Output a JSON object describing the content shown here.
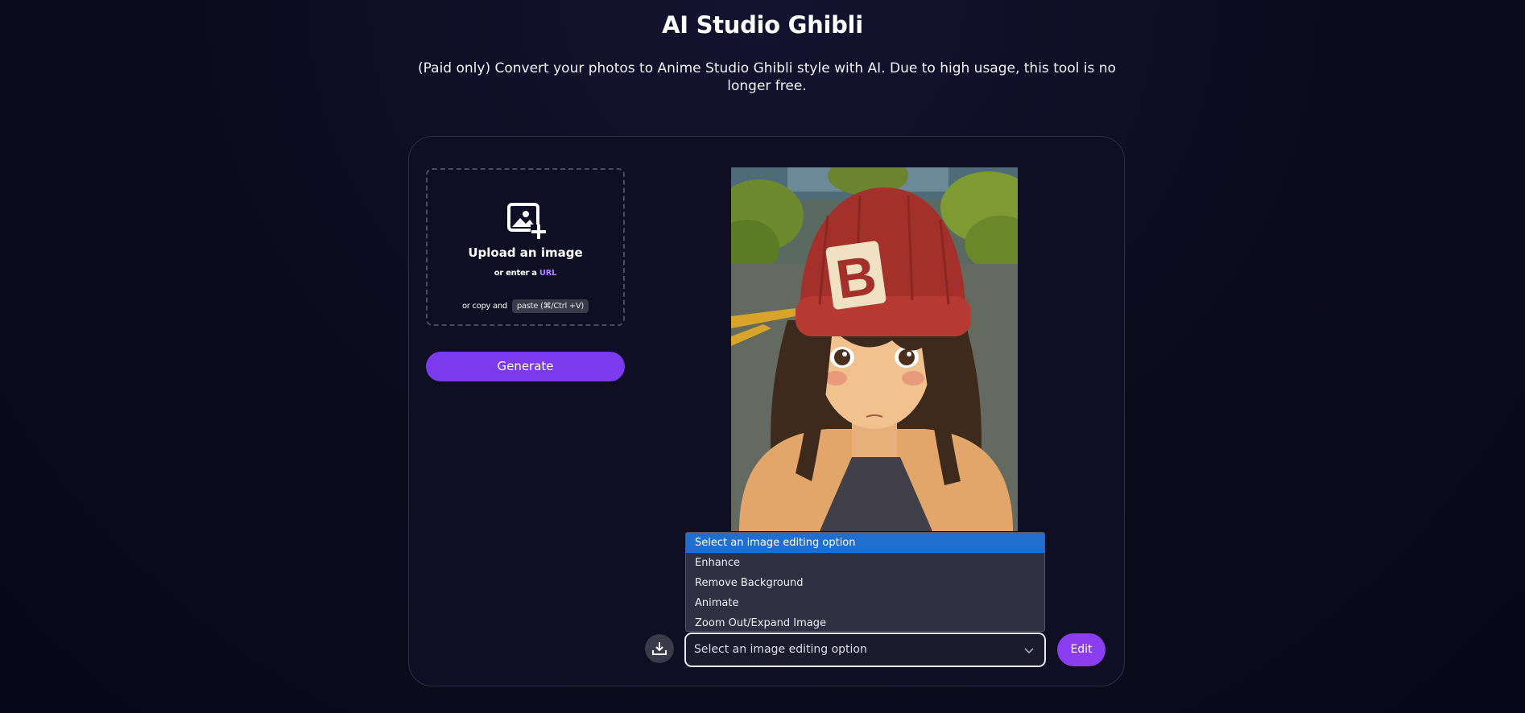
{
  "header": {
    "title": "AI Studio Ghibli",
    "subtitle": "(Paid only) Convert your photos to Anime Studio Ghibli style with AI. Due to high usage, this tool is no longer free."
  },
  "upload": {
    "title": "Upload an image",
    "url_prefix": "or enter a",
    "url_link": "URL",
    "paste_prefix": "or copy and",
    "paste_shortcut": "paste (⌘/Ctrl +V)",
    "icon": "image-add-icon"
  },
  "generate_button": "Generate",
  "result_image": {
    "hat_letter": "B",
    "alt": "anime girl in red beanie"
  },
  "edit_select": {
    "selected": "Select an image editing option",
    "options": [
      "Select an image editing option",
      "Enhance",
      "Remove Background",
      "Animate",
      "Zoom Out/Expand Image"
    ],
    "highlight_color": "#1f6fd1"
  },
  "download_icon": "download-icon",
  "edit_button": "Edit",
  "colors": {
    "accent": "#7c3aed",
    "background": "#0c0b1c"
  }
}
